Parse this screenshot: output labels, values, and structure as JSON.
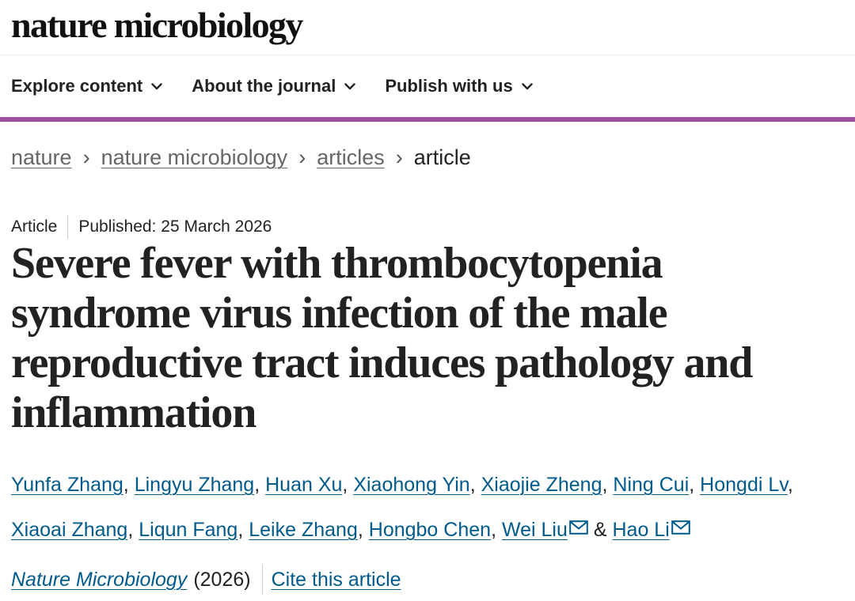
{
  "header": {
    "logo": "nature microbiology"
  },
  "nav": {
    "items": [
      {
        "label": "Explore content",
        "icon": "chevron-down-icon"
      },
      {
        "label": "About the journal",
        "icon": "chevron-down-icon"
      },
      {
        "label": "Publish with us",
        "icon": "chevron-down-icon"
      }
    ],
    "accent_color": "#9c4f9e"
  },
  "breadcrumb": {
    "items": [
      "nature",
      "nature microbiology",
      "articles"
    ],
    "separator": "›",
    "current": "article"
  },
  "article": {
    "type": "Article",
    "published": "Published: 25 March 2026",
    "title": "Severe fever with thrombocytopenia syndrome virus infection of the male reproductive tract induces pathology and inflammation",
    "authors": [
      "Yunfa Zhang",
      "Lingyu Zhang",
      "Huan Xu",
      "Xiaohong Yin",
      "Xiaojie Zheng",
      "Ning Cui",
      "Hongdi Lv",
      "Xiaoai Zhang",
      "Liqun Fang",
      "Leike Zhang",
      "Hongbo Chen",
      "Wei Liu",
      "Hao Li"
    ],
    "author_separator": ",",
    "author_conjunction": "&",
    "journal": "Nature Microbiology",
    "year": "(2026)",
    "cite_label": "Cite this article",
    "link_color": "#005a8c"
  }
}
